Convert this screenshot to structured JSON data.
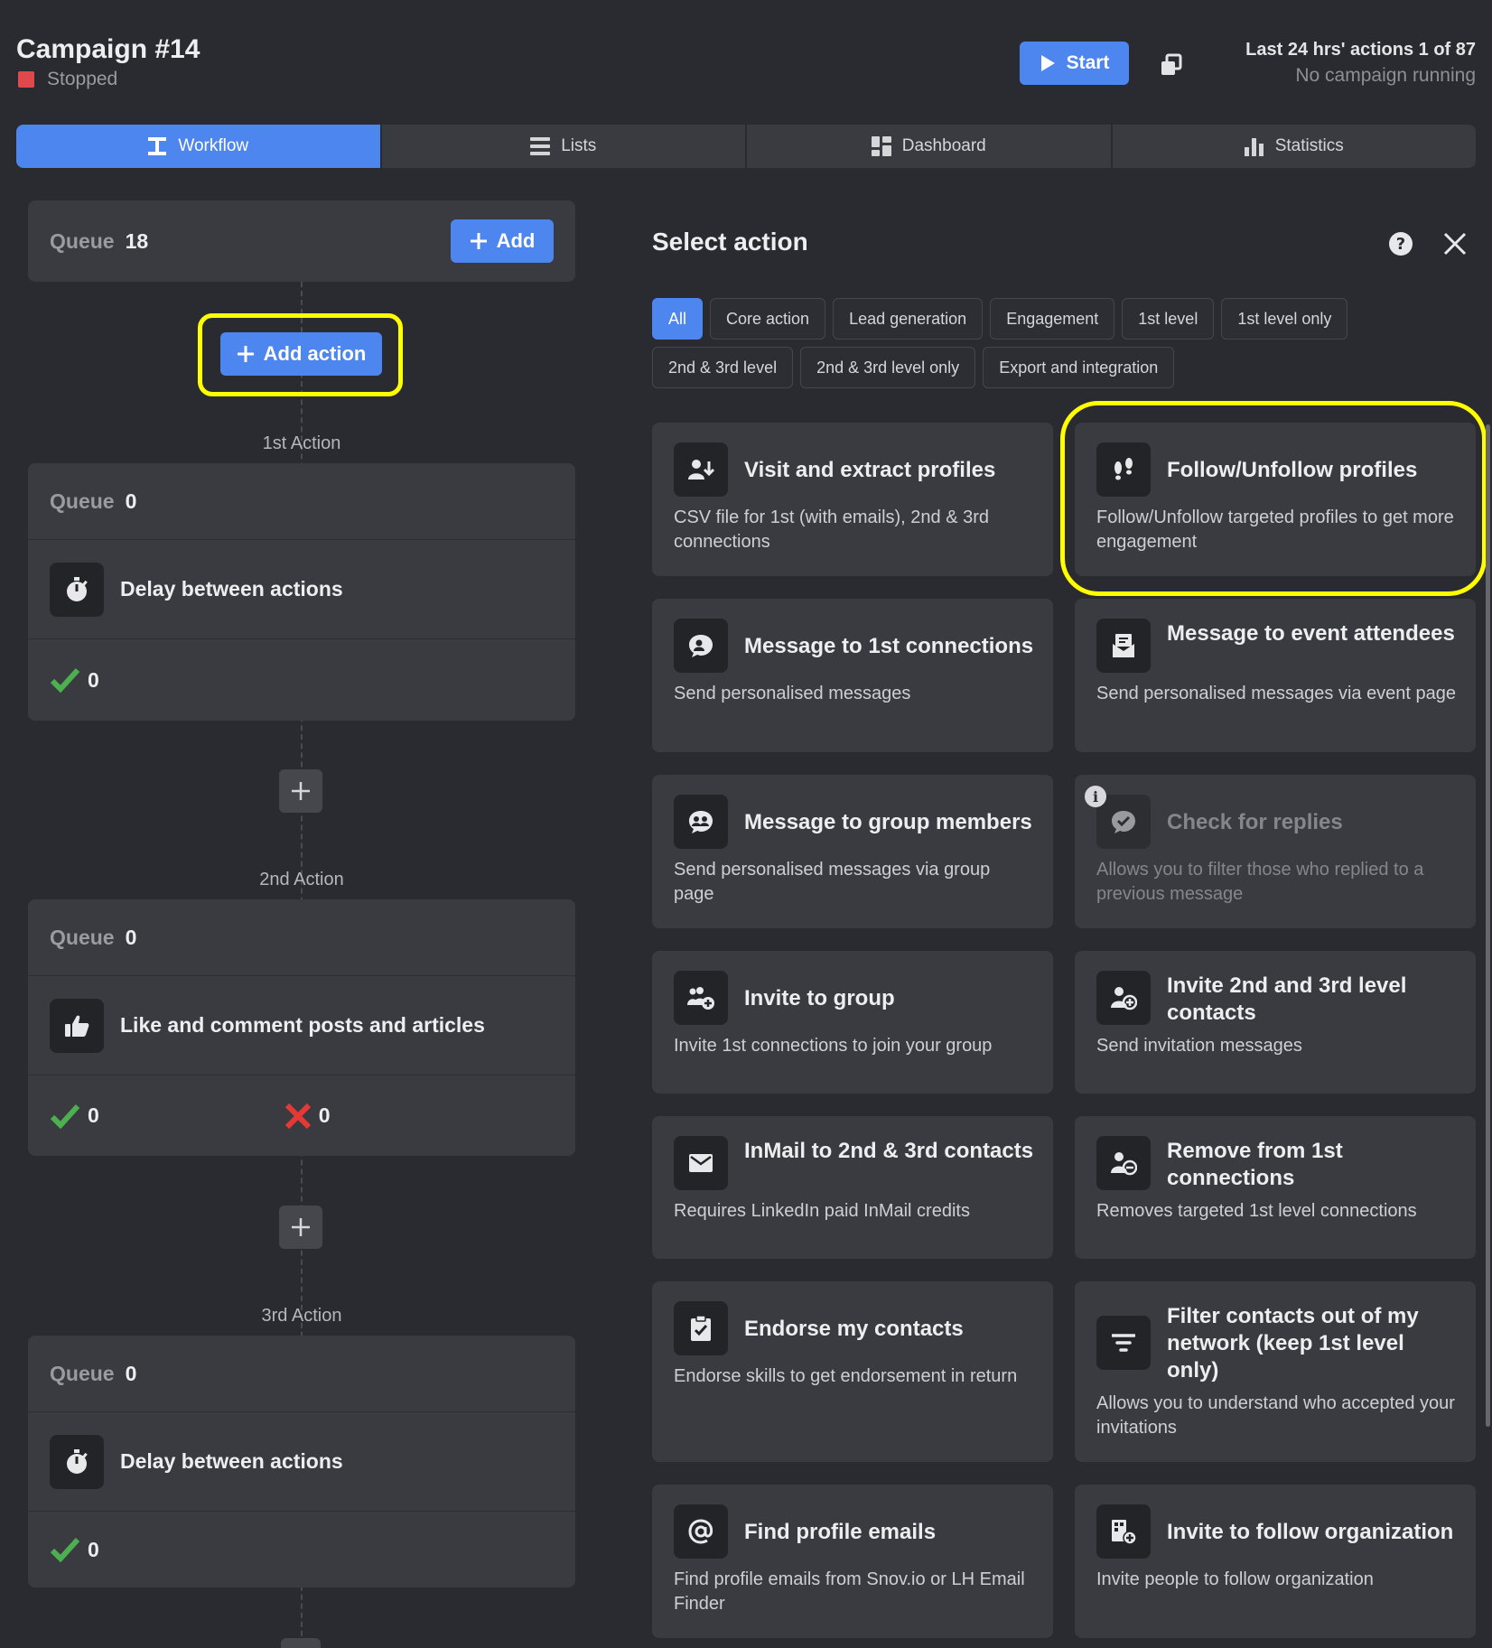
{
  "header": {
    "campaign_title": "Campaign #14",
    "status": "Stopped",
    "status_color": "#e0494b",
    "start_label": "Start",
    "last24": "Last 24 hrs' actions 1 of 87",
    "running": "No campaign running"
  },
  "tabs": [
    {
      "label": "Workflow",
      "icon": "workflow-icon"
    },
    {
      "label": "Lists",
      "icon": "list-icon"
    },
    {
      "label": "Dashboard",
      "icon": "dashboard-icon"
    },
    {
      "label": "Statistics",
      "icon": "bar-chart-icon"
    }
  ],
  "queue_top": {
    "label": "Queue",
    "value": "18",
    "add_label": "Add"
  },
  "add_action_label": "Add action",
  "actions": [
    {
      "label": "1st Action",
      "queue_label": "Queue",
      "queue_value": "0",
      "name": "Delay between actions",
      "success": "0"
    },
    {
      "label": "2nd Action",
      "queue_label": "Queue",
      "queue_value": "0",
      "name": "Like and comment posts and articles",
      "success": "0",
      "fail": "0"
    },
    {
      "label": "3rd Action",
      "queue_label": "Queue",
      "queue_value": "0",
      "name": "Delay between actions",
      "success": "0"
    }
  ],
  "panel": {
    "title": "Select action",
    "chips": [
      "All",
      "Core action",
      "Lead generation",
      "Engagement",
      "1st level",
      "1st level only",
      "2nd & 3rd level",
      "2nd & 3rd level only",
      "Export and integration"
    ],
    "cards": [
      {
        "title": "Visit and extract profiles",
        "desc": "CSV file for 1st (with emails), 2nd & 3rd connections"
      },
      {
        "title": "Follow/Unfollow profiles",
        "desc": "Follow/Unfollow targeted profiles to get more engagement"
      },
      {
        "title": "Message to 1st connections",
        "desc": "Send personalised messages"
      },
      {
        "title": "Message to event attendees",
        "desc": "Send personalised messages via event page"
      },
      {
        "title": "Message to group members",
        "desc": "Send personalised messages via group page"
      },
      {
        "title": "Check for replies",
        "desc": "Allows you to filter those who replied to a previous message"
      },
      {
        "title": "Invite to group",
        "desc": "Invite 1st connections to join your group"
      },
      {
        "title": "Invite 2nd and 3rd level contacts",
        "desc": "Send invitation messages"
      },
      {
        "title": "InMail to 2nd & 3rd contacts",
        "desc": "Requires LinkedIn paid InMail credits"
      },
      {
        "title": "Remove from 1st connections",
        "desc": "Removes targeted 1st level connections"
      },
      {
        "title": "Endorse my contacts",
        "desc": "Endorse skills to get endorsement in return"
      },
      {
        "title": "Filter contacts out of my network (keep 1st level only)",
        "desc": "Allows you to understand who accepted your invitations"
      },
      {
        "title": "Find profile emails",
        "desc": "Find profile emails from Snov.io or LH Email Finder"
      },
      {
        "title": "Invite to follow organization",
        "desc": "Invite people to follow organization"
      }
    ]
  },
  "colors": {
    "accent": "#4e86f0",
    "highlight": "#ffff00",
    "success": "#4caf50",
    "fail": "#e53935"
  }
}
